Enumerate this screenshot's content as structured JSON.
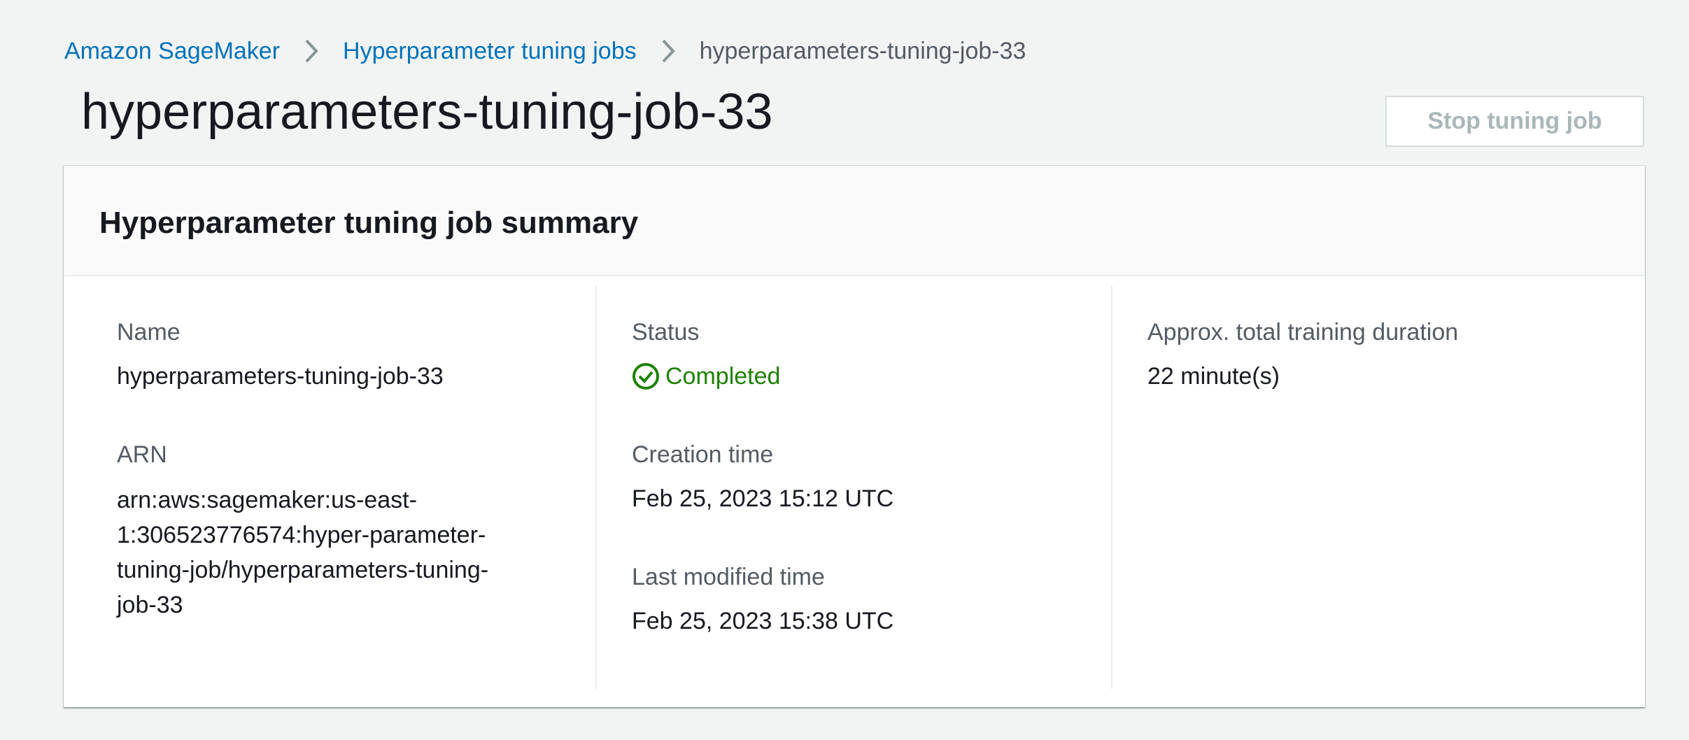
{
  "breadcrumb": {
    "items": [
      {
        "label": "Amazon SageMaker"
      },
      {
        "label": "Hyperparameter tuning jobs"
      },
      {
        "label": "hyperparameters-tuning-job-33"
      }
    ]
  },
  "header": {
    "title": "hyperparameters-tuning-job-33",
    "stop_button_label": "Stop tuning job"
  },
  "summary": {
    "title": "Hyperparameter tuning job summary",
    "name": {
      "label": "Name",
      "value": "hyperparameters-tuning-job-33"
    },
    "arn": {
      "label": "ARN",
      "value": "arn:aws:sagemaker:us-east-1:306523776574:hyper-parameter-tuning-job/hyperparameters-tuning-job-33",
      "lines": [
        "arn:aws:sagemaker:us-east-",
        "1:306523776574:hyper-parameter-",
        "tuning-job/hyperparameters-tuning-",
        "job-33"
      ]
    },
    "status": {
      "label": "Status",
      "value": "Completed",
      "icon": "check-circle-icon",
      "color": "#1d8102"
    },
    "creation_time": {
      "label": "Creation time",
      "value": "Feb 25, 2023 15:12 UTC"
    },
    "last_modified_time": {
      "label": "Last modified time",
      "value": "Feb 25, 2023 15:38 UTC"
    },
    "duration": {
      "label": "Approx. total training duration",
      "value": "22 minute(s)"
    }
  },
  "colors": {
    "link": "#0073bb",
    "background": "#f2f3f3",
    "status_success": "#1d8102",
    "disabled_text": "#aab7b8"
  }
}
